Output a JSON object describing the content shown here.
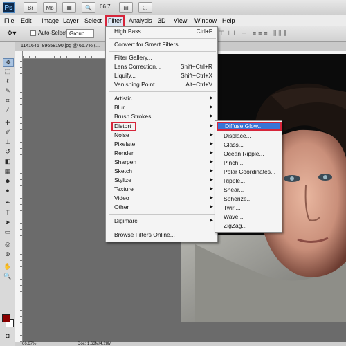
{
  "app": {
    "logo": "Ps",
    "zoom": "66.7",
    "top_icons": [
      "frame-icon",
      "bridge-icon",
      "mb-icon",
      "arrange-icon",
      "hand-icon",
      "zoom-tool-icon",
      "rotate-icon",
      "screen-mode-icon"
    ]
  },
  "menubar": {
    "items": [
      "File",
      "Edit",
      "Image",
      "Layer",
      "Select",
      "Filter",
      "Analysis",
      "3D",
      "View",
      "Window",
      "Help"
    ]
  },
  "options": {
    "auto_select_label": "Auto-Select:",
    "group_value": "Group"
  },
  "document": {
    "tab_title": "1141646_89658190.jpg @ 66.7% (...",
    "status_zoom": "66.67%",
    "status_doc": "Doc: 1.63M/4.28M"
  },
  "filter_menu": {
    "items": [
      {
        "label": "High Pass",
        "shortcut": "Ctrl+F"
      },
      {
        "label": "Convert for Smart Filters"
      },
      {
        "label": "Filter Gallery..."
      },
      {
        "label": "Lens Correction...",
        "shortcut": "Shift+Ctrl+R"
      },
      {
        "label": "Liquify...",
        "shortcut": "Shift+Ctrl+X"
      },
      {
        "label": "Vanishing Point...",
        "shortcut": "Alt+Ctrl+V"
      },
      {
        "label": "Artistic"
      },
      {
        "label": "Blur"
      },
      {
        "label": "Brush Strokes"
      },
      {
        "label": "Distort"
      },
      {
        "label": "Noise"
      },
      {
        "label": "Pixelate"
      },
      {
        "label": "Render"
      },
      {
        "label": "Sharpen"
      },
      {
        "label": "Sketch"
      },
      {
        "label": "Stylize"
      },
      {
        "label": "Texture"
      },
      {
        "label": "Video"
      },
      {
        "label": "Other"
      },
      {
        "label": "Digimarc"
      },
      {
        "label": "Browse Filters Online..."
      }
    ]
  },
  "distort_menu": {
    "items": [
      "Diffuse Glow...",
      "Displace...",
      "Glass...",
      "Ocean Ripple...",
      "Pinch...",
      "Polar Coordinates...",
      "Ripple...",
      "Shear...",
      "Spherize...",
      "Twirl...",
      "Wave...",
      "ZigZag..."
    ],
    "selected": "Diffuse Glow..."
  },
  "colors": {
    "foreground": "#8b0000",
    "background": "#ffffff",
    "highlight": "#3875d7",
    "annotation": "#d6253a"
  }
}
